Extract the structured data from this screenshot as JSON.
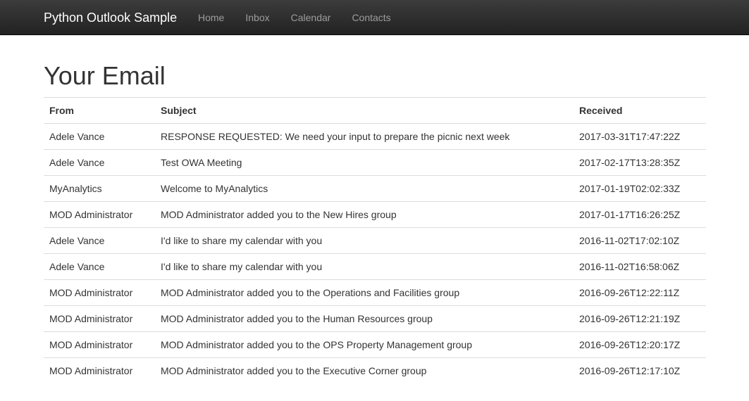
{
  "navbar": {
    "brand": "Python Outlook Sample",
    "links": [
      {
        "label": "Home"
      },
      {
        "label": "Inbox"
      },
      {
        "label": "Calendar"
      },
      {
        "label": "Contacts"
      }
    ]
  },
  "main": {
    "title": "Your Email",
    "columns": [
      "From",
      "Subject",
      "Received"
    ],
    "rows": [
      {
        "from": "Adele Vance",
        "subject": "RESPONSE REQUESTED: We need your input to prepare the picnic next week",
        "received": "2017-03-31T17:47:22Z"
      },
      {
        "from": "Adele Vance",
        "subject": "Test OWA Meeting",
        "received": "2017-02-17T13:28:35Z"
      },
      {
        "from": "MyAnalytics",
        "subject": "Welcome to MyAnalytics",
        "received": "2017-01-19T02:02:33Z"
      },
      {
        "from": "MOD Administrator",
        "subject": "MOD Administrator added you to the New Hires group",
        "received": "2017-01-17T16:26:25Z"
      },
      {
        "from": "Adele Vance",
        "subject": "I'd like to share my calendar with you",
        "received": "2016-11-02T17:02:10Z"
      },
      {
        "from": "Adele Vance",
        "subject": "I'd like to share my calendar with you",
        "received": "2016-11-02T16:58:06Z"
      },
      {
        "from": "MOD Administrator",
        "subject": "MOD Administrator added you to the Operations and Facilities group",
        "received": "2016-09-26T12:22:11Z"
      },
      {
        "from": "MOD Administrator",
        "subject": "MOD Administrator added you to the Human Resources group",
        "received": "2016-09-26T12:21:19Z"
      },
      {
        "from": "MOD Administrator",
        "subject": "MOD Administrator added you to the OPS Property Management group",
        "received": "2016-09-26T12:20:17Z"
      },
      {
        "from": "MOD Administrator",
        "subject": "MOD Administrator added you to the Executive Corner group",
        "received": "2016-09-26T12:17:10Z"
      }
    ]
  }
}
